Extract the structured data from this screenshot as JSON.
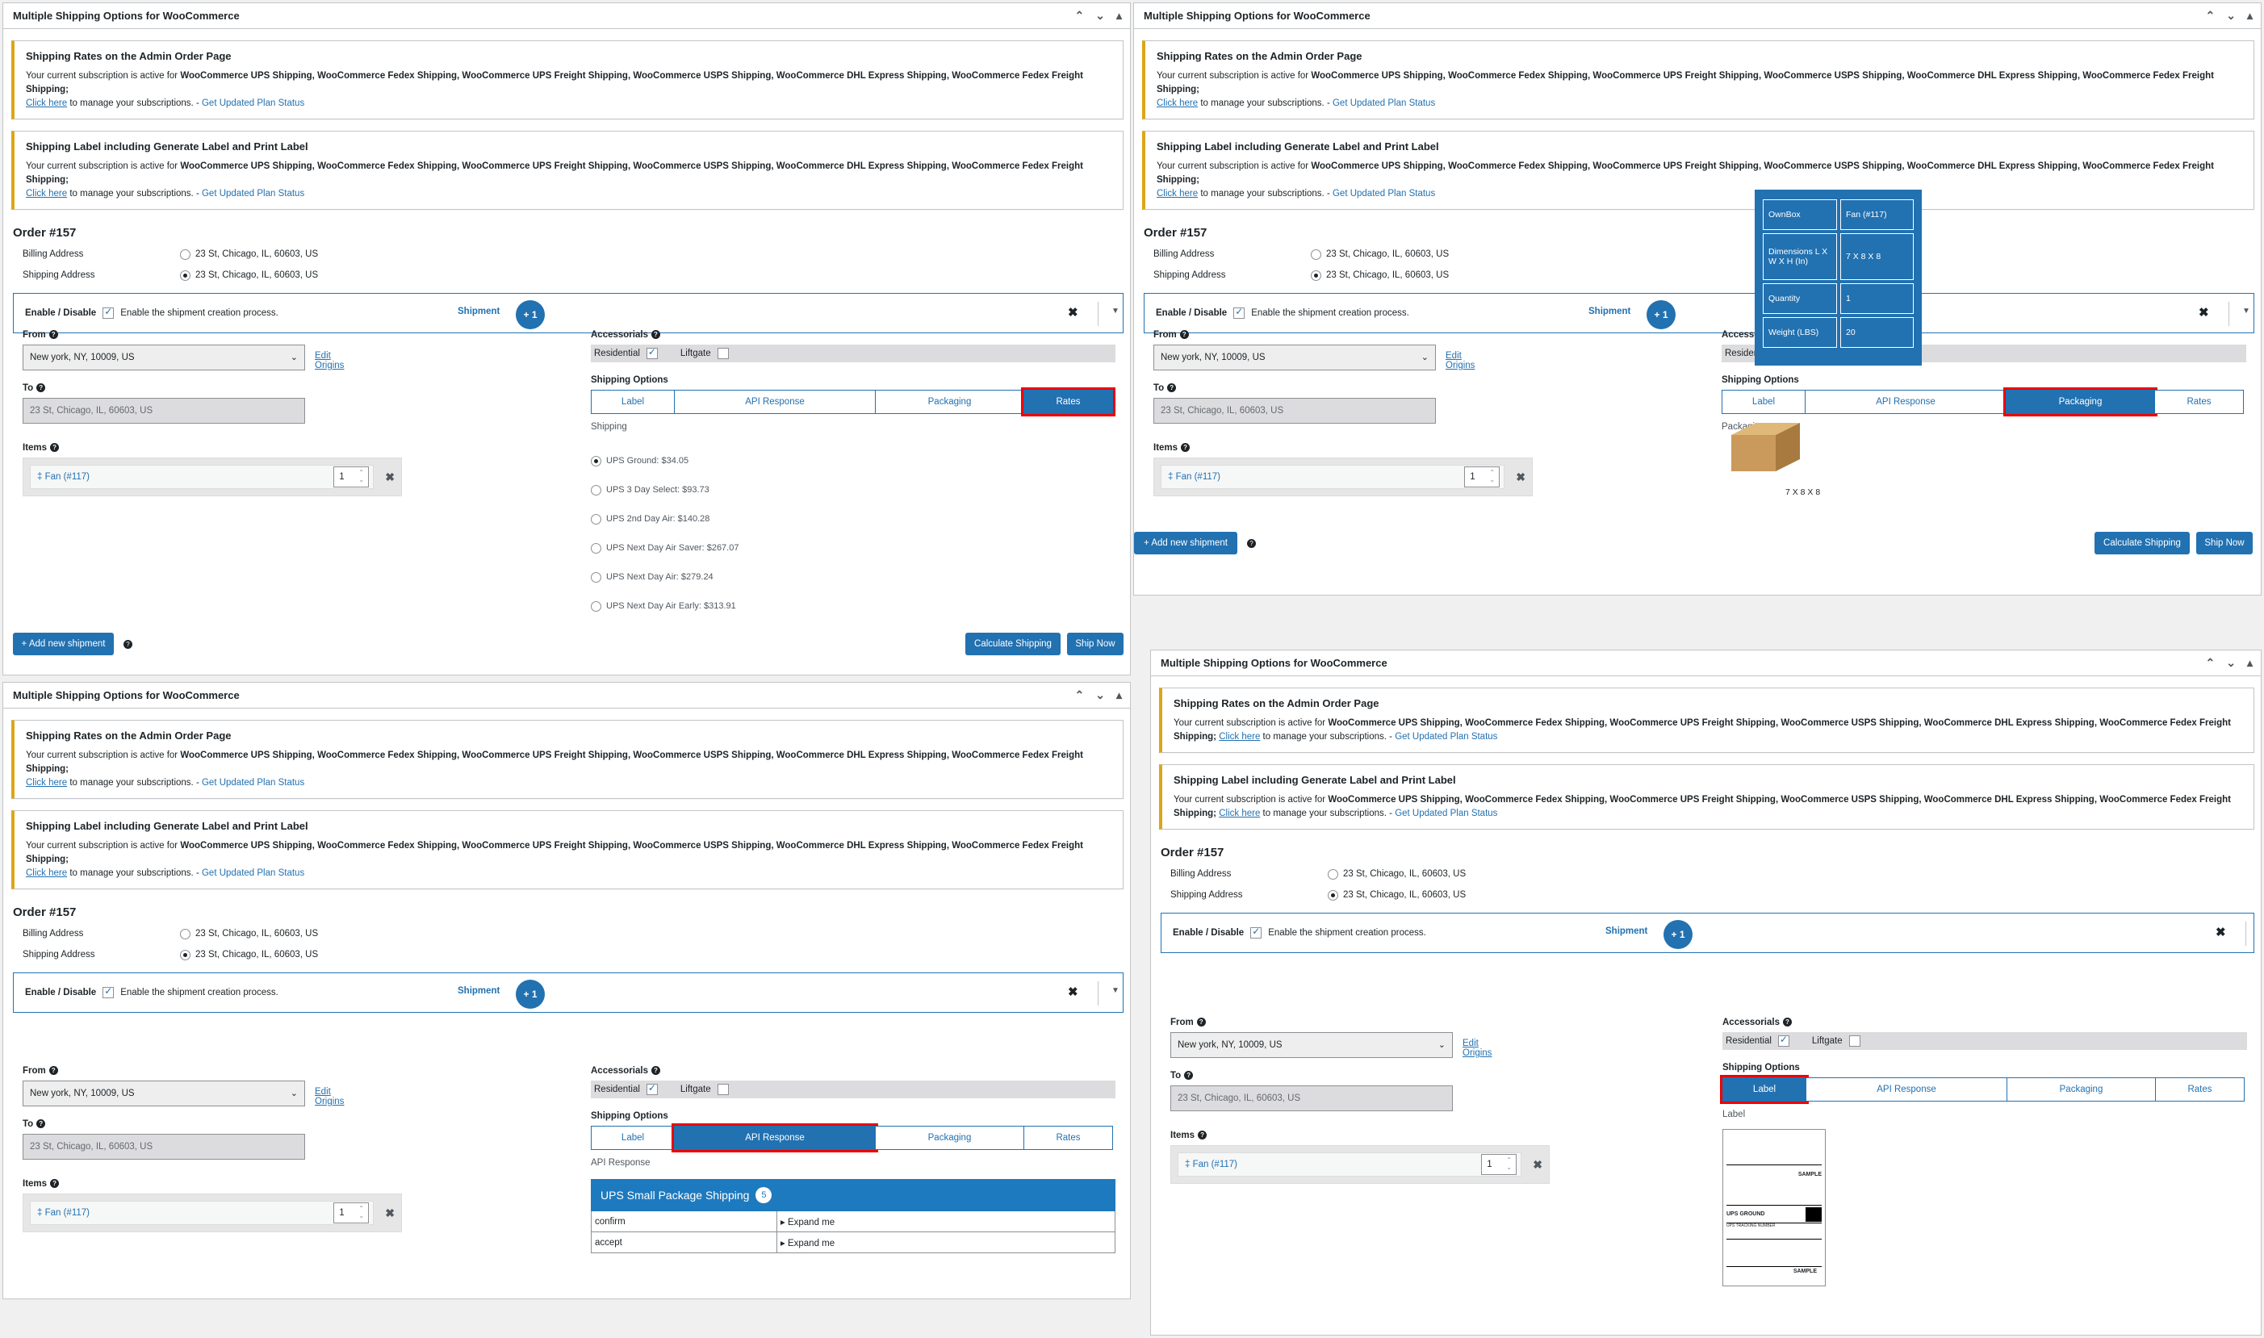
{
  "panel_title": "Multiple Shipping Options for WooCommerce",
  "notice1": {
    "heading": "Shipping Rates on the Admin Order Page",
    "text": "Your current subscription is active for ",
    "products": "WooCommerce UPS Shipping, WooCommerce Fedex Shipping, WooCommerce UPS Freight Shipping, WooCommerce USPS Shipping, WooCommerce DHL Express Shipping, WooCommerce Fedex Freight Shipping;",
    "link": "Click here",
    "tail": " to manage your subscriptions. - ",
    "status_link": "Get Updated Plan Status"
  },
  "notice2": {
    "heading": "Shipping Label including Generate Label and Print Label",
    "text": "Your current subscription is active for ",
    "products": "WooCommerce UPS Shipping, WooCommerce Fedex Shipping, WooCommerce UPS Freight Shipping, WooCommerce USPS Shipping, WooCommerce DHL Express Shipping, WooCommerce Fedex Freight Shipping;",
    "link": "Click here",
    "tail": " to manage your subscriptions. - ",
    "status_link": "Get Updated Plan Status"
  },
  "order_title": "Order #157",
  "billing_label": "Billing Address",
  "shipping_label": "Shipping Address",
  "address": "23 St, Chicago, IL, 60603, US",
  "enable_label": "Enable / Disable",
  "enable_text": "Enable the shipment creation process.",
  "shipment_label": "Shipment",
  "shipment_badge": "+ 1",
  "close_symbol": "✖",
  "from_label": "From",
  "from_value": "New york, NY, 10009, US",
  "edit_origins": "Edit Origins",
  "to_label": "To",
  "to_value": "23 St, Chicago, IL, 60603, US",
  "items_label": "Items",
  "item_name": "‡ Fan (#117)",
  "item_qty": "1",
  "accessorials_label": "Accessorials",
  "residential_label": "Residential",
  "liftgate_label": "Liftgate",
  "shipping_options_label": "Shipping Options",
  "tabs": [
    "Label",
    "API Response",
    "Packaging",
    "Rates"
  ],
  "shipping_sub": "Shipping",
  "rates": [
    "UPS Ground: $34.05",
    "UPS 3 Day Select: $93.73",
    "UPS 2nd Day Air: $140.28",
    "UPS Next Day Air Saver: $267.07",
    "UPS Next Day Air: $279.24",
    "UPS Next Day Air Early: $313.91"
  ],
  "add_shipment": "+ Add new shipment",
  "calculate": "Calculate Shipping",
  "ship_now": "Ship Now",
  "packaging_sub": "Packaging",
  "packaging_popup": [
    {
      "k": "OwnBox",
      "v": "Fan (#117)"
    },
    {
      "k": "Dimensions L X W X H (In)",
      "v": "7 X 8 X 8"
    },
    {
      "k": "Quantity",
      "v": "1"
    },
    {
      "k": "Weight (LBS)",
      "v": "20"
    }
  ],
  "box_dims": "7 X 8 X 8",
  "api_sub": "API Response",
  "api_header": "UPS Small Package Shipping",
  "api_count": "5",
  "api_rows": [
    {
      "k": "confirm",
      "v": "▸ Expand me"
    },
    {
      "k": "accept",
      "v": "▸ Expand me"
    }
  ],
  "label_sub": "Label",
  "label_text": {
    "sample": "SAMPLE",
    "ground": "UPS GROUND",
    "tracking": "UPS TRACKING NUMBER"
  },
  "colors": {
    "accent": "#2271b1",
    "highlight": "#e00000",
    "notice": "#dba617"
  }
}
